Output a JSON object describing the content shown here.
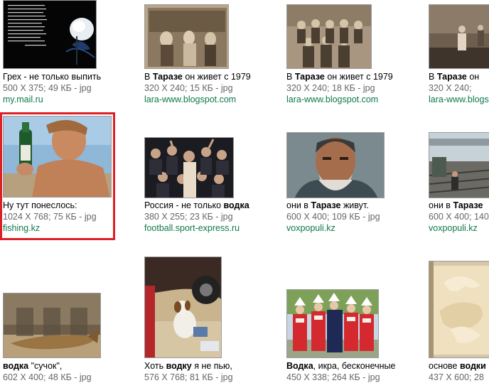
{
  "results": [
    {
      "title_pre": "Грех - не только выпить",
      "title_bold": "",
      "title_post": "",
      "meta": "500 X 375; 49 КБ - jpg",
      "source": "my.mail.ru",
      "image": "dark-rose-poem-image"
    },
    {
      "title_pre": "В ",
      "title_bold": "Таразе",
      "title_post": " он живет с 1979",
      "meta": "320 X 240; 15 КБ - jpg",
      "source": "lara-www.blogspot.com",
      "image": "old-family-photo"
    },
    {
      "title_pre": "В ",
      "title_bold": "Таразе",
      "title_post": " он живет с 1979",
      "meta": "320 X 240; 18 КБ - jpg",
      "source": "lara-www.blogspot.com",
      "image": "old-soldiers-photo"
    },
    {
      "title_pre": "В ",
      "title_bold": "Таразе",
      "title_post": " он",
      "meta": "320 X 240; ",
      "source": "lara-www.blogs",
      "image": "old-street-photo"
    },
    {
      "title_pre": "Ну тут понеслось:",
      "title_bold": "",
      "title_post": "",
      "meta": "1024 X 768; 75 КБ - jpg",
      "source": "fishing.kz",
      "image": "man-with-bottle-photo",
      "selected": true
    },
    {
      "title_pre": "Россия - не только ",
      "title_bold": "водка",
      "title_post": "",
      "meta": "380 X 255; 23 КБ - jpg",
      "source": "football.sport-express.ru",
      "image": "crowd-photo"
    },
    {
      "title_pre": "они в ",
      "title_bold": "Таразе",
      "title_post": " живут.",
      "meta": "600 X 400; 109 КБ - jpg",
      "source": "voxpopuli.kz",
      "image": "old-man-portrait"
    },
    {
      "title_pre": "они в ",
      "title_bold": "Таразе",
      "title_post": "",
      "meta": "600 X 400; 140",
      "source": "voxpopuli.kz",
      "image": "railway-photo"
    },
    {
      "title_pre": "",
      "title_bold": "водка",
      "title_post": " \"сучок\",",
      "meta": "602 X 400; 48 КБ - jpg",
      "source": "",
      "image": "dried-fish-photo"
    },
    {
      "title_pre": "Хоть ",
      "title_bold": "водку",
      "title_post": " я не пью,",
      "meta": "576 X 768; 81 КБ - jpg",
      "source": "",
      "image": "dog-by-car-photo"
    },
    {
      "title_pre": "",
      "title_bold": "Водка",
      "title_post": ", икра, бесконечные",
      "meta": "450 X 338; 264 КБ - jpg",
      "source": "",
      "image": "folk-costume-photo"
    },
    {
      "title_pre": "основе ",
      "title_bold": "водки",
      "title_post": "",
      "meta": "437 X 600; 28",
      "source": "",
      "image": "carved-panel-photo"
    }
  ]
}
